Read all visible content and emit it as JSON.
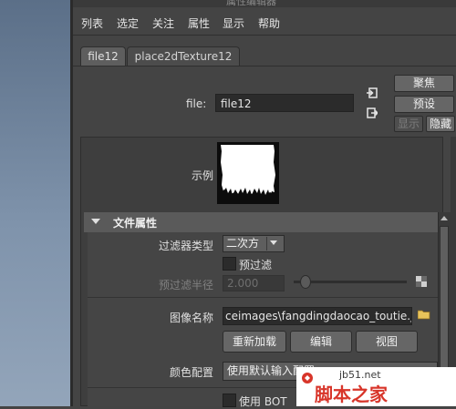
{
  "window": {
    "title": "属性编辑器"
  },
  "menu": [
    "列表",
    "选定",
    "关注",
    "属性",
    "显示",
    "帮助"
  ],
  "tabs": [
    {
      "label": "file12",
      "active": true
    },
    {
      "label": "place2dTexture12",
      "active": false
    }
  ],
  "file_row": {
    "label": "file:",
    "value": "file12"
  },
  "side_buttons": {
    "focus": "聚焦",
    "preset": "预设",
    "show": "显示",
    "hide": "隐藏"
  },
  "sample": {
    "label": "示例"
  },
  "section": {
    "title": "文件属性"
  },
  "fields": {
    "filter_type": {
      "label": "过滤器类型",
      "value": "二次方"
    },
    "prefilter": {
      "label": "预过滤",
      "checked": false
    },
    "prefilter_radius": {
      "label": "预过滤半径",
      "value": "2.000",
      "slider_fraction": 0.1
    },
    "image_name": {
      "label": "图像名称",
      "value": "ceimages\\fangdingdaocao_toutie.jpg"
    },
    "buttons": {
      "reload": "重新加载",
      "edit": "编辑",
      "view": "视图"
    },
    "colorspace": {
      "label": "颜色配置",
      "value": "使用默认输入配置"
    },
    "use_bot": {
      "label": "使用 BOT",
      "checked": false
    }
  },
  "watermark": {
    "url": "jb51.net",
    "text": "脚本之家"
  },
  "colors": {
    "background": "#444444",
    "field": "#2b2b2b",
    "button": "#666666",
    "header": "#5a5a5a"
  }
}
